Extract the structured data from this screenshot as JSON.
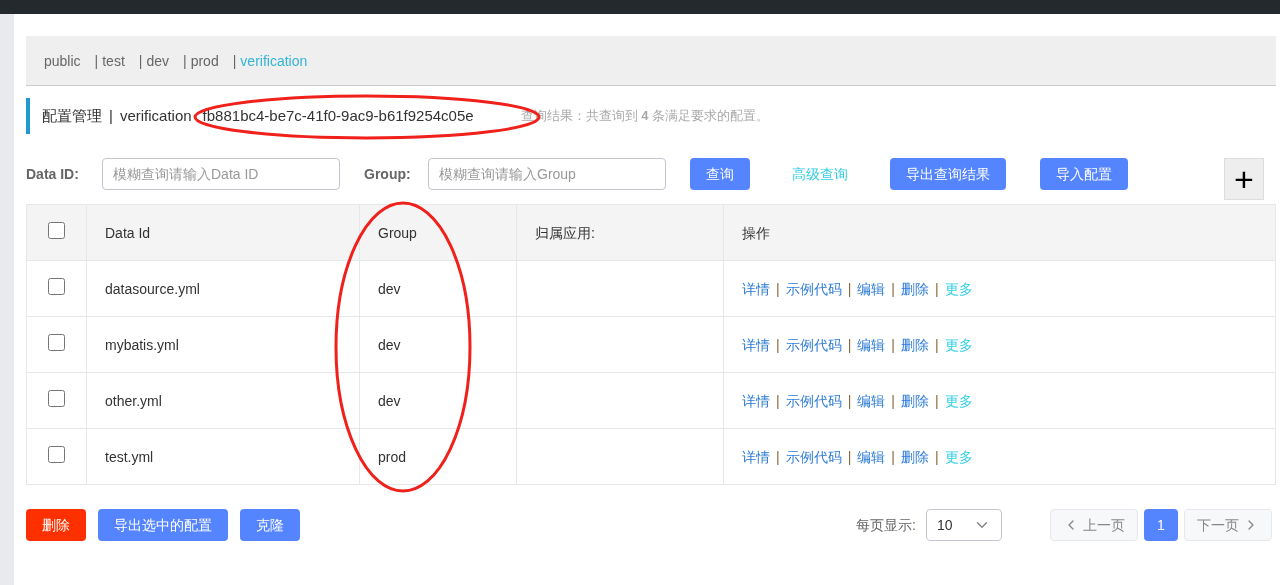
{
  "namespaces": [
    {
      "label": "public",
      "selected": false
    },
    {
      "separator": "|",
      "label": "test",
      "selected": false
    },
    {
      "separator": "|",
      "label": "dev",
      "selected": false
    },
    {
      "separator": "|",
      "label": "prod",
      "selected": false
    },
    {
      "separator": "|",
      "label": "verification",
      "selected": true
    }
  ],
  "header": {
    "title": "配置管理",
    "separator": "|",
    "namespace": "verification",
    "namespace_id": "fb881bc4-be7c-41f0-9ac9-b61f9254c05e",
    "result": "查询结果：共查询到 **4** 条满足要求的配置。"
  },
  "search": {
    "data_id_label": "Data ID:",
    "data_id_placeholder": "模糊查询请输入Data ID",
    "group_label": "Group:",
    "group_placeholder": "模糊查询请输入Group",
    "buttons": [
      {
        "label": "查询",
        "kind": "button"
      },
      {
        "label": "高级查询",
        "kind": "link"
      },
      {
        "label": "导出查询结果",
        "kind": "button"
      },
      {
        "label": "导入配置",
        "kind": "button"
      }
    ],
    "add": "+"
  },
  "table": {
    "columns": [
      "Data Id",
      "Group",
      "归属应用:",
      "操作"
    ],
    "select_all_checked": false,
    "rows": [
      {
        "checked": false,
        "data_id": "datasource.yml",
        "group": "dev",
        "actions": [
          "详情",
          "示例代码",
          "编辑",
          "删除",
          "更多"
        ]
      },
      {
        "checked": false,
        "data_id": "mybatis.yml",
        "group": "dev",
        "actions": [
          "详情",
          "示例代码",
          "编辑",
          "删除",
          "更多"
        ]
      },
      {
        "checked": false,
        "data_id": "other.yml",
        "group": "dev",
        "actions": [
          "详情",
          "示例代码",
          "编辑",
          "删除",
          "更多"
        ]
      },
      {
        "checked": false,
        "data_id": "test.yml",
        "group": "prod",
        "actions": [
          "详情",
          "示例代码",
          "编辑",
          "删除",
          "更多"
        ]
      }
    ],
    "action_separator": "|"
  },
  "footer": {
    "buttons": [
      {
        "label": "删除",
        "kind": "danger"
      },
      {
        "label": "导出选中的配置",
        "kind": "primary"
      },
      {
        "label": "克隆",
        "kind": "primary"
      }
    ],
    "page_size_label": "每页显示:",
    "page_size": "10",
    "prev": "上一页",
    "page": "1",
    "next": "下一页"
  }
}
